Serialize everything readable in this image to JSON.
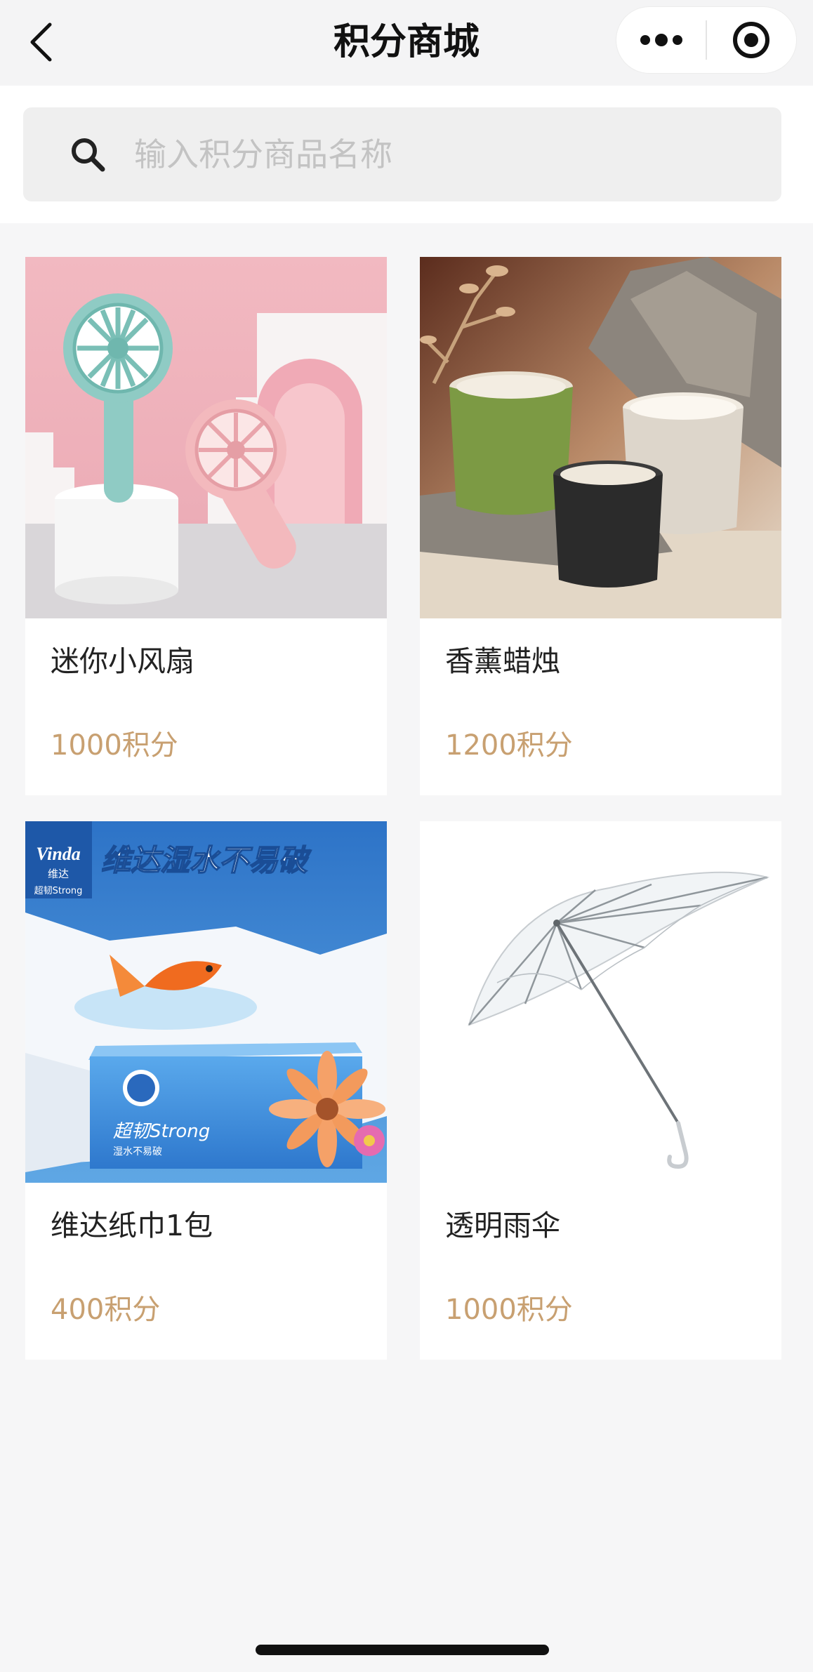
{
  "header": {
    "title": "积分商城"
  },
  "search": {
    "placeholder": "输入积分商品名称"
  },
  "products": [
    {
      "name": "迷你小风扇",
      "price": "1000积分"
    },
    {
      "name": "香薰蜡烛",
      "price": "1200积分"
    },
    {
      "name": "维达纸巾1包",
      "price": "400积分"
    },
    {
      "name": "透明雨伞",
      "price": "1000积分"
    }
  ],
  "product_image_text": {
    "tissue_headline": "维达湿水不易破",
    "tissue_brand": "Vinda",
    "tissue_brand_cn": "维达",
    "tissue_strong": "超韧Strong",
    "tissue_strong_sub": "湿水不易破"
  },
  "icons": {
    "back": "chevron-left-icon",
    "more": "more-dots-icon",
    "close_miniprogram": "target-circle-icon",
    "search": "search-icon"
  },
  "colors": {
    "accent_price": "#c8a071",
    "page_background": "#f6f6f7",
    "card_background": "#ffffff"
  }
}
